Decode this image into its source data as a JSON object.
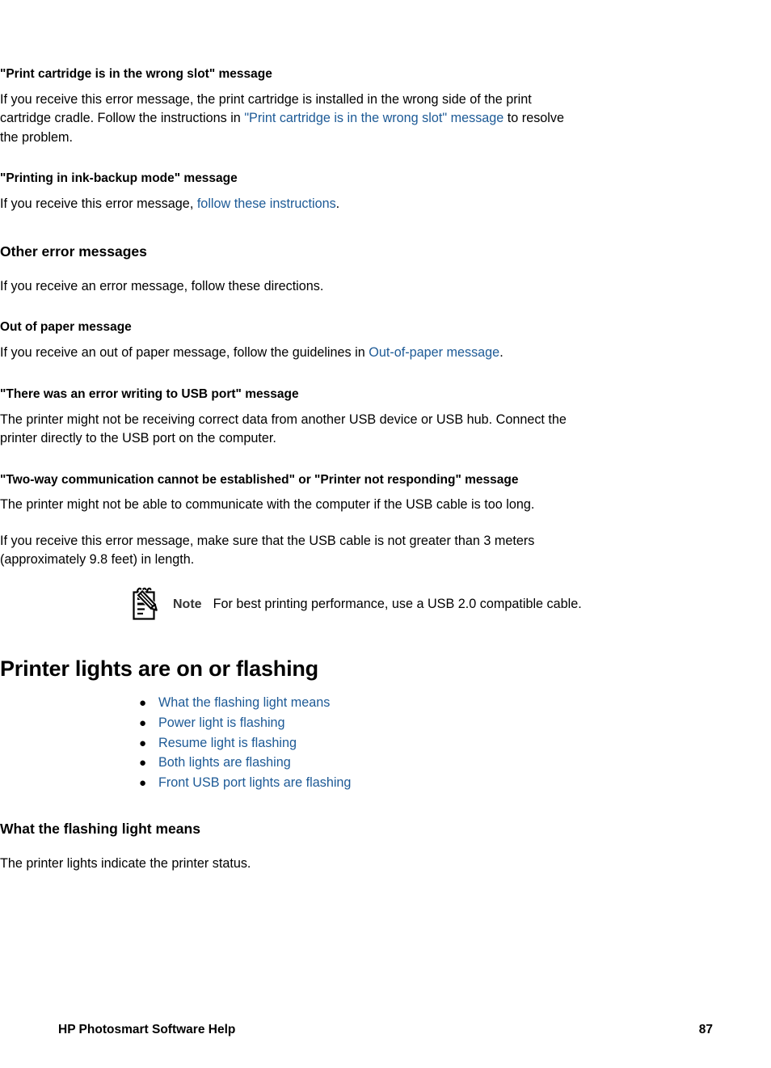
{
  "colors": {
    "link": "#1d5a96",
    "text": "#000000",
    "note_label": "#333333",
    "page_background": "#ffffff"
  },
  "sections": {
    "wrong_slot": {
      "heading": "\"Print cartridge is in the wrong slot\" message",
      "body_pre": "If you receive this error message, the print cartridge is installed in the wrong side of the print cartridge cradle. Follow the instructions in ",
      "body_link": "\"Print cartridge is in the wrong slot\" message",
      "body_post": " to resolve the problem."
    },
    "ink_backup": {
      "heading": "\"Printing in ink-backup mode\" message",
      "body_pre": "If you receive this error message, ",
      "body_link": "follow these instructions",
      "body_post": "."
    },
    "other_error_messages": {
      "heading": "Other error messages",
      "body": "If you receive an error message, follow these directions."
    },
    "out_of_paper": {
      "heading": "Out of paper message",
      "body_pre": "If you receive an out of paper message, follow the guidelines in ",
      "body_link": "Out-of-paper message",
      "body_post": "."
    },
    "usb_write_error": {
      "heading": "\"There was an error writing to USB port\" message",
      "body": "The printer might not be receiving correct data from another USB device or USB hub. Connect the printer directly to the USB port on the computer."
    },
    "two_way": {
      "heading": "\"Two-way communication cannot be established\" or \"Printer not responding\" message",
      "body_1": "The printer might not be able to communicate with the computer if the USB cable is too long.",
      "body_2": "If you receive this error message, make sure that the USB cable is not greater than 3 meters (approximately 9.8 feet) in length.",
      "note": {
        "icon": "notepad-pencil-icon",
        "label": "Note",
        "text": "For best printing performance, use a USB 2.0 compatible cable."
      }
    },
    "printer_lights": {
      "heading": "Printer lights are on or flashing",
      "links": [
        "What the flashing light means",
        "Power light is flashing",
        "Resume light is flashing",
        "Both lights are flashing",
        "Front USB port lights are flashing"
      ],
      "bullet_glyph": "●"
    },
    "what_flashing_means": {
      "heading": "What the flashing light means",
      "body": "The printer lights indicate the printer status."
    }
  },
  "footer": {
    "title": "HP Photosmart Software Help",
    "page_number": "87"
  }
}
